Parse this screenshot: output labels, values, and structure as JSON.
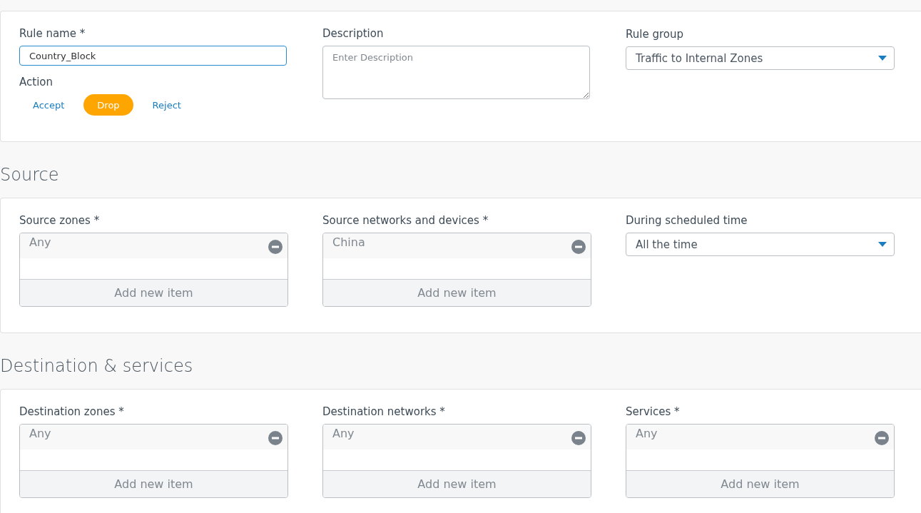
{
  "general": {
    "rule_name": {
      "label": "Rule name *",
      "value": "Country_Block"
    },
    "action": {
      "label": "Action",
      "options": [
        {
          "label": "Accept",
          "selected": false
        },
        {
          "label": "Drop",
          "selected": true
        },
        {
          "label": "Reject",
          "selected": false
        }
      ]
    },
    "description": {
      "label": "Description",
      "placeholder": "Enter Description"
    },
    "rule_group": {
      "label": "Rule group",
      "value": "Traffic to Internal Zones"
    }
  },
  "sections": [
    {
      "title": "Source",
      "fields": [
        {
          "kind": "list",
          "label": "Source zones *",
          "items": [
            "Any"
          ],
          "add_label": "Add new item"
        },
        {
          "kind": "list",
          "label": "Source networks and devices *",
          "items": [
            "China"
          ],
          "add_label": "Add new item"
        },
        {
          "kind": "select",
          "label": "During scheduled time",
          "value": "All the time"
        }
      ]
    },
    {
      "title": "Destination & services",
      "fields": [
        {
          "kind": "list",
          "label": "Destination zones *",
          "items": [
            "Any"
          ],
          "add_label": "Add new item"
        },
        {
          "kind": "list",
          "label": "Destination networks *",
          "items": [
            "Any"
          ],
          "add_label": "Add new item"
        },
        {
          "kind": "list",
          "label": "Services *",
          "items": [
            "Any"
          ],
          "add_label": "Add new item"
        }
      ]
    }
  ]
}
